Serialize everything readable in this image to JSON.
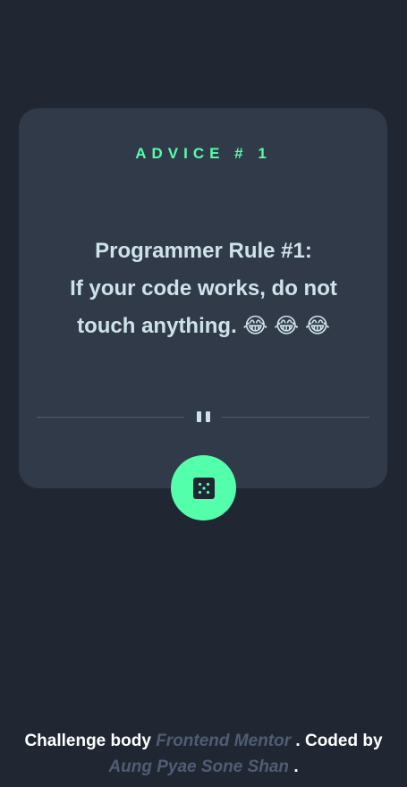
{
  "card": {
    "advice_label": "ADVICE # 1",
    "quote_lines": [
      "Programmer Rule #1:",
      "If your code works, do not",
      "touch anything. 😂 😂 😂"
    ]
  },
  "icons": {
    "divider": "pause-icon",
    "button": "dice-icon"
  },
  "footer": {
    "challenge_text": "Challenge body",
    "challenge_link": "Frontend Mentor",
    "coded_by_text": ". Coded by",
    "author_link": "Aung Pyae Sone Shan",
    "end_text": "."
  },
  "colors": {
    "background": "#202733",
    "card": "#313A49",
    "accent": "#53FFAA",
    "text": "#CEE3E9",
    "muted": "#4F5D74"
  }
}
